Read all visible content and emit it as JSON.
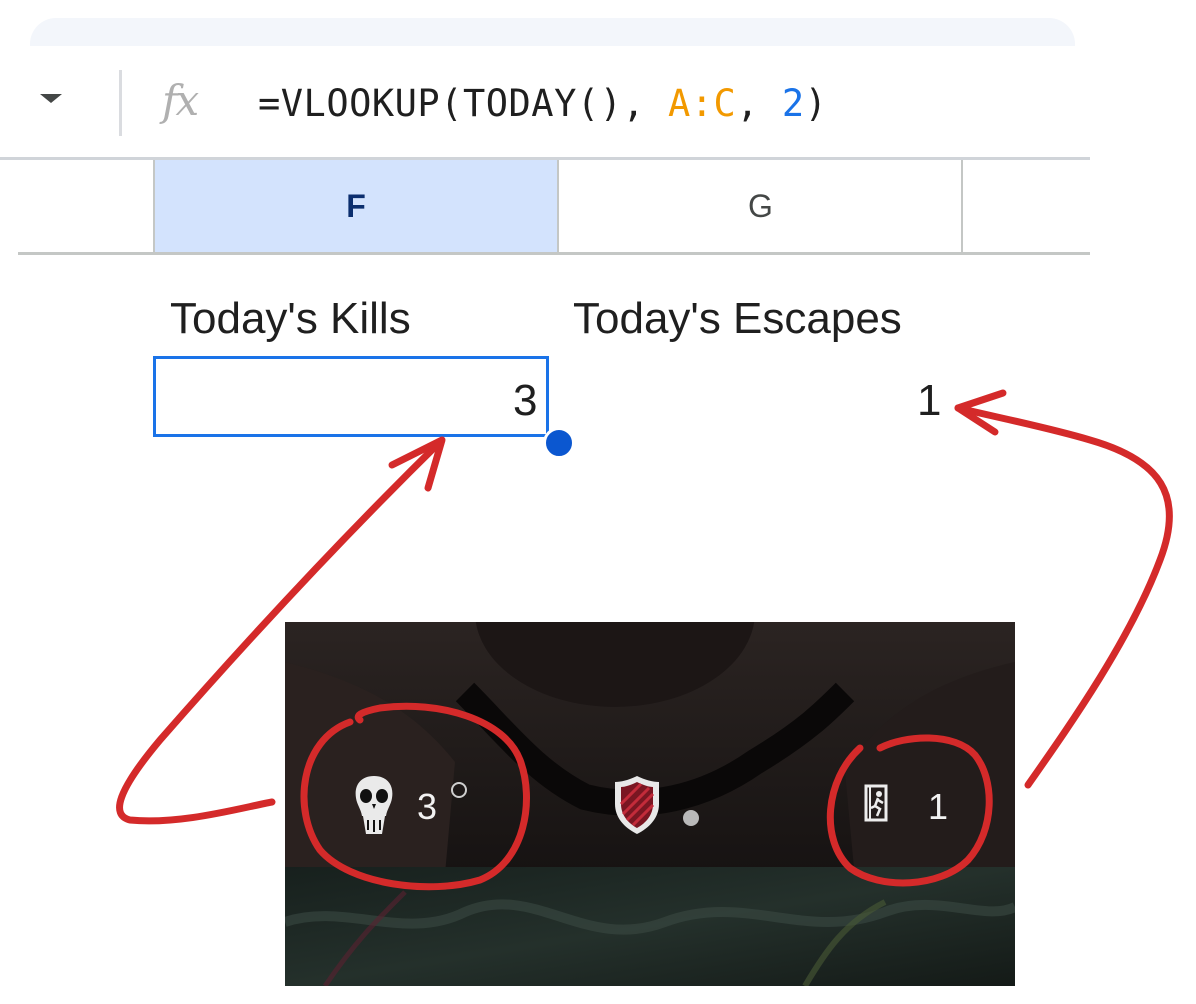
{
  "formula_bar": {
    "fx_label": "fx",
    "formula_prefix": "=VLOOKUP(TODAY(), ",
    "formula_range": "A:C",
    "formula_sep": ", ",
    "formula_index": "2",
    "formula_suffix": ")"
  },
  "columns": [
    {
      "label": "F",
      "selected": true
    },
    {
      "label": "G",
      "selected": false
    }
  ],
  "cells": {
    "f_header": "Today's Kills",
    "g_header": "Today's Escapes",
    "f_value": "3",
    "g_value": "1"
  },
  "game_hud": {
    "kills_icon": "skull-icon",
    "kills_value": "3",
    "emblem_icon": "shield-emblem-icon",
    "escapes_icon": "exit-door-icon",
    "escapes_value": "1"
  },
  "colors": {
    "selection_blue": "#1a73e8",
    "header_selected_bg": "#d3e3fd",
    "range_orange": "#f29900",
    "annotation_red": "#d42a2a"
  }
}
